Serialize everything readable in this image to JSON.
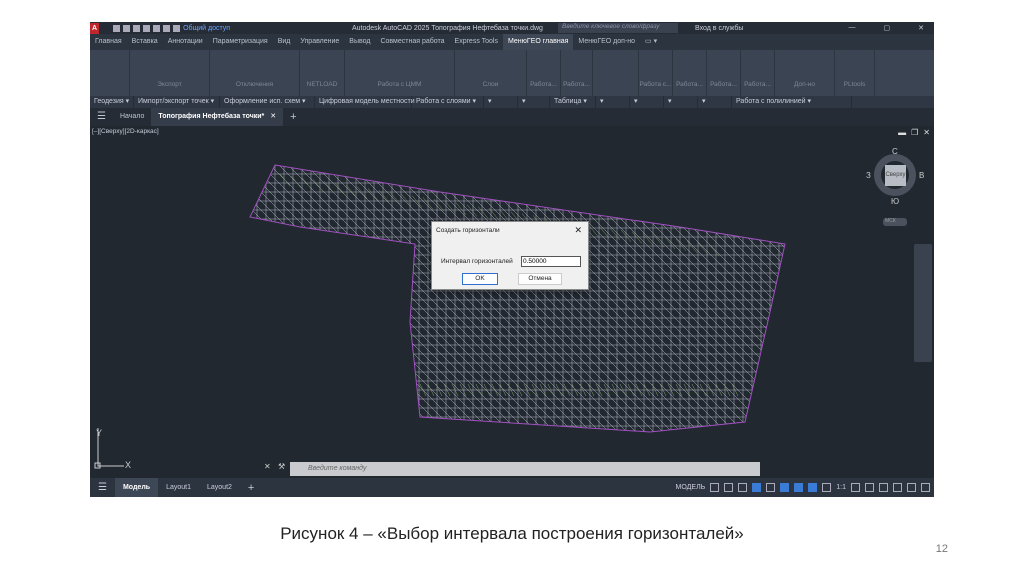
{
  "titlebar": {
    "logo": "A",
    "share": "Общий доступ",
    "title": "Autodesk AutoCAD 2025   Топография Нефтебаза точки.dwg",
    "search_placeholder": "Введите ключевое слово/фразу",
    "account": "Вход в службы",
    "window_buttons": [
      "—",
      "▢",
      "✕"
    ]
  },
  "ribbon_tabs": [
    "Главная",
    "Вставка",
    "Аннотации",
    "Параметризация",
    "Вид",
    "Управление",
    "Вывод",
    "Совместная работа",
    "Express Tools",
    "МенюГЕО главная",
    "МенюГЕО доп-но",
    "▭ ▾"
  ],
  "active_tab": "МенюГЕО главная",
  "ribbon_buttons": [
    "",
    "Экспорт",
    "Отключения",
    "NETLOAD",
    "Работа с ЦММ",
    "Слои",
    "Работа...",
    "Работа...",
    "",
    "Работа с...",
    "Работа...",
    "Работа...",
    "Работа...",
    "Доп-но",
    "PLtools"
  ],
  "panel_labels": [
    "Геодезия ▾",
    "Импорт/экспорт точек ▾",
    "Оформление исп. схем ▾",
    "Цифровая модель местности",
    "Работа с слоями ▾",
    "▾",
    "▾",
    "Таблица ▾",
    "▾",
    "▾",
    "▾",
    "▾",
    "Работа с полилинией ▾"
  ],
  "file_tabs": {
    "menu": "☰",
    "home": "Начало",
    "active": "Топография Нефтебаза точки*",
    "close": "✕",
    "add": "+"
  },
  "viewport": {
    "label": "[–][Сверху][2D-каркас]",
    "ucs_y": "Y",
    "ucs_x": "X"
  },
  "viewcube": {
    "north": "С",
    "south": "Ю",
    "west": "З",
    "east": "В",
    "face": "Сверху",
    "wcs": "МСК"
  },
  "dialog": {
    "title": "Создать горизонтали",
    "close": "✕",
    "field_label": "Интервал горизонталей",
    "field_value": "0.50000",
    "ok": "OK",
    "cancel": "Отмена"
  },
  "command": {
    "placeholder": "Введите команду",
    "close": "✕"
  },
  "status": {
    "layouts": [
      "Модель",
      "Layout1",
      "Layout2"
    ],
    "add": "+",
    "mode": "МОДЕЛЬ",
    "scale": "1:1"
  },
  "caption": "Рисунок 4 – «Выбор интервала построения горизонталей»",
  "page_number": "12",
  "colors": {
    "bg": "#212830",
    "mesh": "#b8b8c8",
    "mesh_green": "#7fa86a",
    "mesh_border": "#a050c0",
    "accent": "#3a7bd5"
  }
}
